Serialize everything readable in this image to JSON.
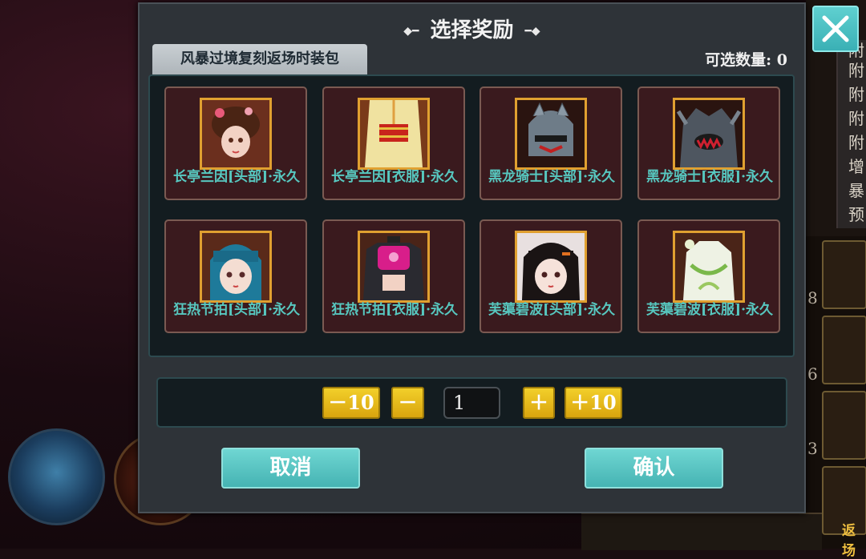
{
  "dialog": {
    "title": "选择奖励",
    "tab_label": "风暴过境复刻返场时装包",
    "selectable_count": "可选数量: 0"
  },
  "items": [
    {
      "label": "长亭兰因[头部]·永久",
      "icon": "hair-ornament-head-icon"
    },
    {
      "label": "长亭兰因[衣服]·永久",
      "icon": "robe-clothes-icon"
    },
    {
      "label": "黑龙骑士[头部]·永久",
      "icon": "knight-helmet-icon"
    },
    {
      "label": "黑龙骑士[衣服]·永久",
      "icon": "dragon-armor-icon"
    },
    {
      "label": "狂热节拍[头部]·永久",
      "icon": "blue-hair-head-icon"
    },
    {
      "label": "狂热节拍[衣服]·永久",
      "icon": "pink-top-clothes-icon"
    },
    {
      "label": "芙蕖碧波[头部]·永久",
      "icon": "black-hair-head-icon"
    },
    {
      "label": "芙蕖碧波[衣服]·永久",
      "icon": "green-dress-clothes-icon"
    }
  ],
  "quantity": {
    "minus10": "－10",
    "minus1": "－",
    "value": "1",
    "plus1": "＋",
    "plus10": "＋10"
  },
  "actions": {
    "cancel": "取消",
    "confirm": "确认"
  },
  "background": {
    "side_chars": [
      "附",
      "附",
      "附",
      "附",
      "附",
      "增",
      "暴",
      "预"
    ],
    "slot_numbers": [
      "8",
      "6",
      "3"
    ],
    "bottom_right_text": "返场"
  },
  "colors": {
    "accent_cyan": "#4fc0c0",
    "button_yellow": "#e8bb1c",
    "item_label_teal": "#57c8c0",
    "icon_border_gold": "#e0a030"
  }
}
